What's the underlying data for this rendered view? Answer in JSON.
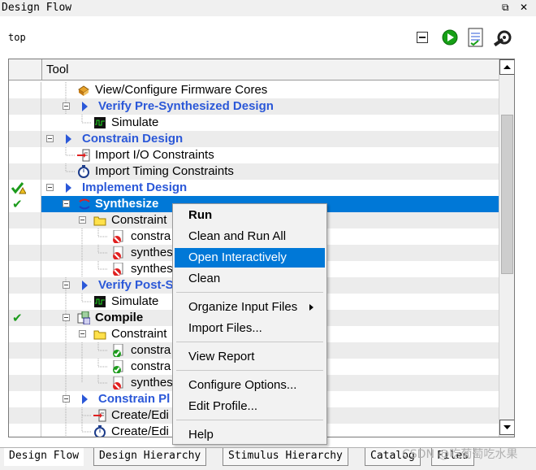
{
  "window": {
    "title": "Design Flow",
    "top_label": "top"
  },
  "tree": {
    "header_tool": "Tool",
    "rows": [
      {
        "label": "View/Configure Firmware Cores"
      },
      {
        "label": "Verify Pre-Synthesized Design"
      },
      {
        "label": "Simulate"
      },
      {
        "label": "Constrain Design"
      },
      {
        "label": "Import I/O Constraints"
      },
      {
        "label": "Import Timing Constraints"
      },
      {
        "label": "Implement Design"
      },
      {
        "label": "Synthesize"
      },
      {
        "label": "Constraint"
      },
      {
        "label": "constra"
      },
      {
        "label": "synthes"
      },
      {
        "label": "synthes"
      },
      {
        "label": "Verify Post-S"
      },
      {
        "label": "Simulate"
      },
      {
        "label": "Compile"
      },
      {
        "label": "Constraint"
      },
      {
        "label": "constra"
      },
      {
        "label": "constra"
      },
      {
        "label": "synthes"
      },
      {
        "label": "Constrain Pl"
      },
      {
        "label": "Create/Edi"
      },
      {
        "label": "Create/Edi"
      }
    ]
  },
  "context_menu": {
    "items": [
      "Run",
      "Clean and Run All",
      "Open Interactively",
      "Clean",
      "Organize Input Files",
      "Import Files...",
      "View Report",
      "Configure Options...",
      "Edit Profile...",
      "Help"
    ]
  },
  "tabs": [
    "Design Flow",
    "Design Hierarchy",
    "Stimulus Hierarchy",
    "Catalog",
    "Files"
  ],
  "watermark": "CSDN @吃葡萄吃水果",
  "colors": {
    "selection": "#0078d7",
    "link_blue": "#2b58d8",
    "check_green": "#1c9b1c"
  }
}
